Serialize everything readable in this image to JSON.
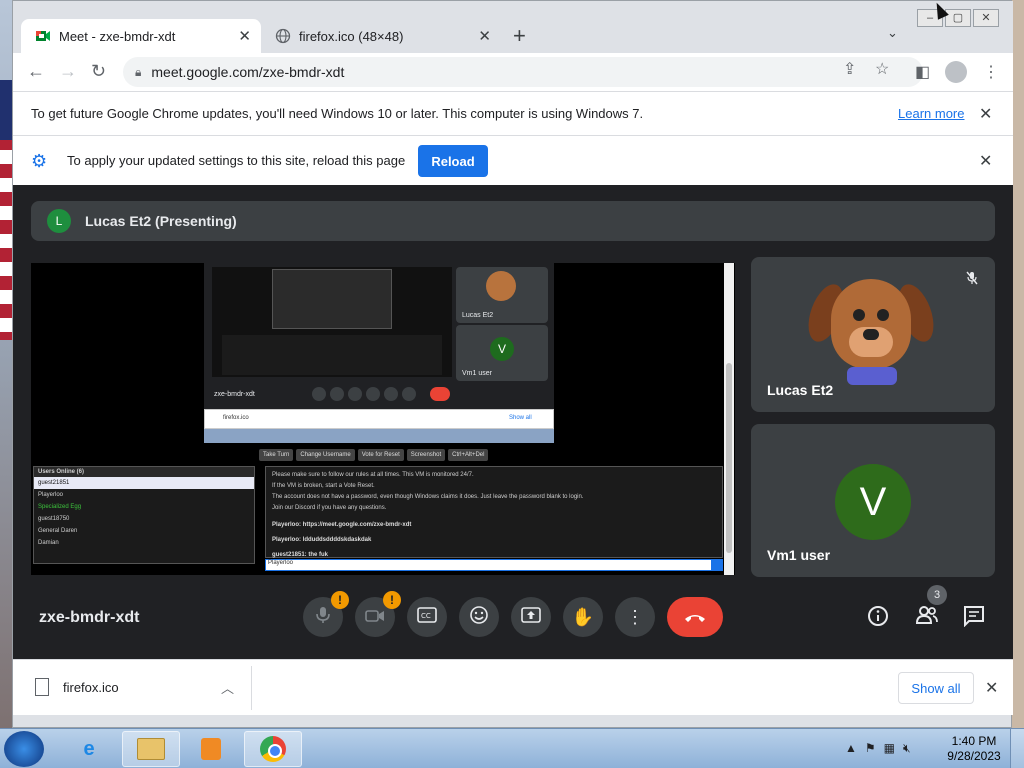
{
  "browser": {
    "tabs": [
      {
        "title": "Meet - zxe-bmdr-xdt",
        "active": true
      },
      {
        "title": "firefox.ico (48×48)",
        "active": false
      }
    ],
    "new_tab_label": "+",
    "url": "meet.google.com/zxe-bmdr-xdt"
  },
  "infobars": {
    "update_message": "To get future Google Chrome updates, you'll need Windows 10 or later. This computer is using Windows 7.",
    "learn_more": "Learn more",
    "reload_message": "To apply your updated settings to this site, reload this page",
    "reload_button": "Reload"
  },
  "meet": {
    "presenter_initial": "L",
    "presenter_label": "Lucas Et2 (Presenting)",
    "meeting_code": "zxe-bmdr-xdt",
    "participants": [
      {
        "name": "Lucas Et2",
        "muted": true
      },
      {
        "name": "Vm1 user",
        "initial": "V"
      }
    ],
    "people_count": "3",
    "shared_screen": {
      "meeting_code": "zxe-bmdr-xdt",
      "tile_names": [
        "Lucas Et2",
        "Vm1 user"
      ],
      "download_text": "firefox.ico",
      "download_show_all": "Show all",
      "vm_buttons": [
        "Take Turn",
        "Change Username",
        "Vote for Reset",
        "Screenshot",
        "Ctrl+Alt+Del"
      ],
      "users_header": "Users Online (6)",
      "users": [
        "guest21851",
        "Playerloo",
        "Specialized Egg",
        "guest18750",
        "General Daren",
        "Damian"
      ],
      "chat_lines": [
        "Please make sure to follow our rules at all times. This VM is monitored 24/7.",
        "If the VM is broken, start a Vote Reset.",
        "The account does not have a password, even though Windows claims it does. Just leave the password blank to login.",
        "Join our Discord if you have any questions."
      ],
      "chat_msg1": "Playerloo: https://meet.google.com/zxe-bmdr-xdt",
      "chat_msg2": "Playerloo: ldduddsddddskdaskdak",
      "chat_msg3": "guest21851: the fuk",
      "input_name": "Playerloo"
    }
  },
  "downloads": {
    "file_name": "firefox.ico",
    "show_all": "Show all"
  },
  "taskbar": {
    "time": "1:40 PM",
    "date": "9/28/2023"
  },
  "colors": {
    "meet_bg": "#202124",
    "tile_bg": "#3c4043",
    "end_call": "#ea4335",
    "alert": "#f29900",
    "reload_button": "#1a73e8"
  },
  "icons": {
    "controls": [
      "microphone-icon",
      "camera-icon",
      "captions-icon",
      "emoji-icon",
      "present-icon",
      "raise-hand-icon",
      "more-options-icon",
      "end-call-icon"
    ],
    "side": [
      "info-icon",
      "people-icon",
      "chat-icon"
    ]
  }
}
